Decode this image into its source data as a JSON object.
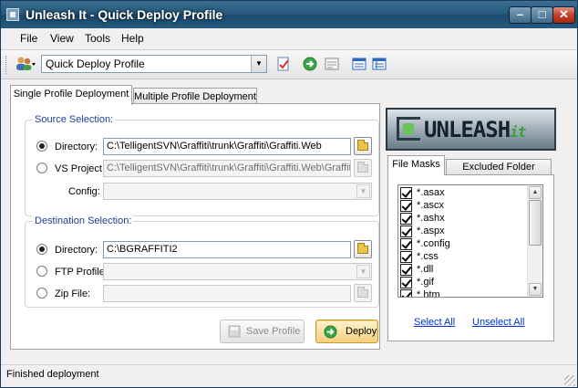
{
  "window": {
    "title": "Unleash It - Quick Deploy Profile"
  },
  "menu": [
    "File",
    "View",
    "Tools",
    "Help"
  ],
  "toolbar": {
    "profile_value": "Quick Deploy Profile"
  },
  "tabs": [
    "Single Profile Deployment",
    "Multiple Profile Deployment"
  ],
  "source": {
    "title": "Source Selection:",
    "directory_label": "Directory:",
    "directory_value": "C:\\TelligentSVN\\Graffiti\\trunk\\Graffiti\\Graffiti.Web",
    "vs_label": "VS Project:",
    "vs_value": "C:\\TelligentSVN\\Graffiti\\trunk\\Graffiti\\Graffiti.Web\\Graffiti.W",
    "config_label": "Config:"
  },
  "destination": {
    "title": "Destination Selection:",
    "directory_label": "Directory:",
    "directory_value": "C:\\BGRAFFITI2",
    "ftp_label": "FTP Profile",
    "zip_label": "Zip File:"
  },
  "buttons": {
    "save": "Save Profile",
    "deploy": "Deploy"
  },
  "logo": {
    "main": "UNLEASH",
    "suffix": "it"
  },
  "mask_tabs": [
    "File Masks",
    "Excluded Folder Masks"
  ],
  "file_masks": [
    "*.asax",
    "*.ascx",
    "*.ashx",
    "*.aspx",
    "*.config",
    "*.css",
    "*.dll",
    "*.gif",
    "*.htm"
  ],
  "links": {
    "select_all": "Select All",
    "unselect_all": "Unselect All"
  },
  "status": "Finished deployment",
  "colors": {
    "titlebar": "#275a7f",
    "group_title": "#1c3f94",
    "link": "#0033cc",
    "deploy_accent": "#f2cf7c"
  }
}
